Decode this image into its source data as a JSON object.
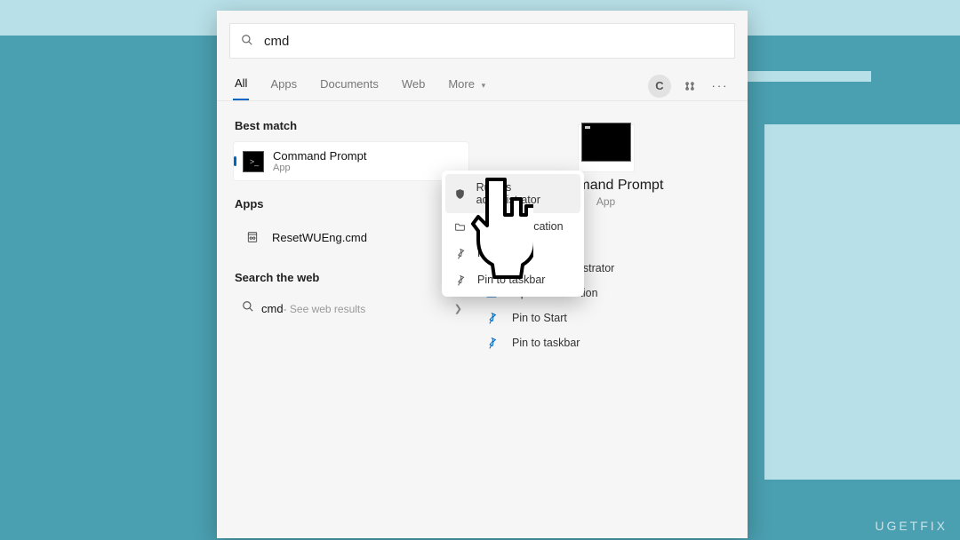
{
  "search": {
    "query": "cmd",
    "icon": "search-icon"
  },
  "tabs": {
    "items": [
      "All",
      "Apps",
      "Documents",
      "Web"
    ],
    "active_index": 0,
    "more_label": "More"
  },
  "top_right": {
    "avatar_letter": "C"
  },
  "left": {
    "best_match_heading": "Best match",
    "best_match": {
      "title": "Command Prompt",
      "subtitle": "App"
    },
    "apps_heading": "Apps",
    "apps": [
      {
        "title": "ResetWUEng.cmd",
        "icon": "script-file-icon"
      }
    ],
    "web_heading": "Search the web",
    "web": {
      "query": "cmd",
      "suffix": " - See web results"
    }
  },
  "detail": {
    "title": "Command Prompt",
    "subtitle": "App",
    "actions": [
      {
        "icon": "shield-icon",
        "label": "Run as administrator"
      },
      {
        "icon": "folder-icon",
        "label": "Open file location"
      },
      {
        "icon": "pin-icon",
        "label": "Pin to Start"
      },
      {
        "icon": "pin-icon",
        "label": "Pin to taskbar"
      }
    ]
  },
  "context_menu": {
    "items": [
      {
        "icon": "shield-icon",
        "label": "Run as administrator"
      },
      {
        "icon": "folder-icon",
        "label": "Open file location"
      },
      {
        "icon": "pin-icon",
        "label": "Pin to Start"
      },
      {
        "icon": "pin-icon",
        "label": "Pin to taskbar"
      }
    ],
    "hover_index": 0
  },
  "watermark": "UGETFIX"
}
